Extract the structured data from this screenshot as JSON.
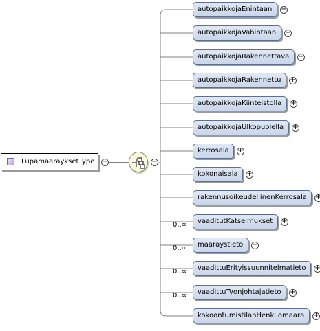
{
  "root_type": {
    "name": "LupamaarayksetType"
  },
  "compositor": {
    "kind": "sequence"
  },
  "glyphs": {
    "collapse": "−",
    "expand": "+"
  },
  "elements": [
    {
      "name": "autopaikkojaEnintaan",
      "cardinality": ""
    },
    {
      "name": "autopaikkojaVahintaan",
      "cardinality": ""
    },
    {
      "name": "autopaikkojaRakennettava",
      "cardinality": ""
    },
    {
      "name": "autopaikkojaRakennettu",
      "cardinality": ""
    },
    {
      "name": "autopaikkojaKiinteistolla",
      "cardinality": ""
    },
    {
      "name": "autopaikkojaUlkopuolella",
      "cardinality": ""
    },
    {
      "name": "kerrosala",
      "cardinality": ""
    },
    {
      "name": "kokonaisala",
      "cardinality": ""
    },
    {
      "name": "rakennusoikeudellinenKerrosala",
      "cardinality": ""
    },
    {
      "name": "vaaditutKatselmukset",
      "cardinality": "0..∞"
    },
    {
      "name": "maaraystieto",
      "cardinality": "0..∞"
    },
    {
      "name": "vaadittuErityissuunnitelmatieto",
      "cardinality": "0..∞"
    },
    {
      "name": "vaadittuTyonjohtajatieto",
      "cardinality": "0..∞"
    },
    {
      "name": "kokoontumistilanHenkilomaara",
      "cardinality": ""
    }
  ]
}
